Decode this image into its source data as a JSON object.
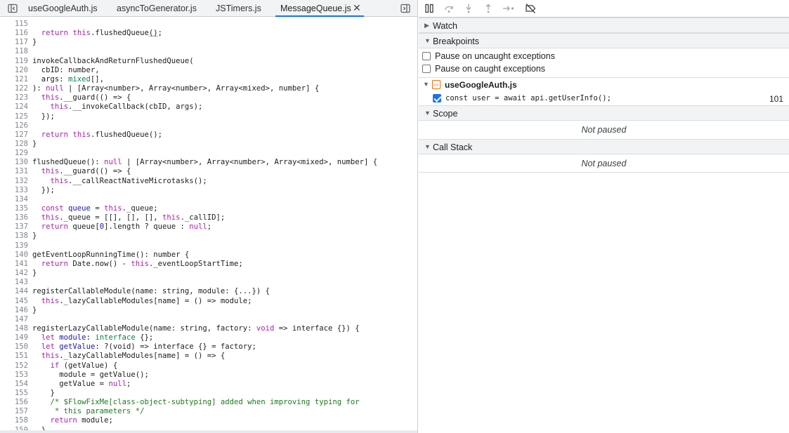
{
  "tabs": [
    {
      "label": "useGoogleAuth.js",
      "active": false
    },
    {
      "label": "asyncToGenerator.js",
      "active": false
    },
    {
      "label": "JSTimers.js",
      "active": false
    },
    {
      "label": "MessageQueue.js",
      "active": true
    }
  ],
  "tab_close_glyph": "✕",
  "code_lines": [
    {
      "n": "115",
      "html": ""
    },
    {
      "n": "116",
      "html": "  <span class=\"kw\">return</span> <span class=\"kw\">this</span>.flushedQueue<span class=\"hl\">()</span>;"
    },
    {
      "n": "117",
      "html": "}"
    },
    {
      "n": "118",
      "html": ""
    },
    {
      "n": "119",
      "html": "invokeCallbackAndReturnFlushedQueue("
    },
    {
      "n": "120",
      "html": "  cbID: number,"
    },
    {
      "n": "121",
      "html": "  args: <span class=\"ty\">mixed</span>[],"
    },
    {
      "n": "122",
      "html": "): <span class=\"kw\">null</span> | [Array&lt;number&gt;, Array&lt;number&gt;, Array&lt;mixed&gt;, number] {"
    },
    {
      "n": "123",
      "html": "  <span class=\"kw\">this</span>.__guard(() =&gt; {"
    },
    {
      "n": "124",
      "html": "    <span class=\"kw\">this</span>.__invokeCallback(cbID, args);"
    },
    {
      "n": "125",
      "html": "  });"
    },
    {
      "n": "126",
      "html": ""
    },
    {
      "n": "127",
      "html": "  <span class=\"kw\">return</span> <span class=\"kw\">this</span>.flushedQueue();"
    },
    {
      "n": "128",
      "html": "}"
    },
    {
      "n": "129",
      "html": ""
    },
    {
      "n": "130",
      "html": "flushedQueue(): <span class=\"kw\">null</span> | [Array&lt;number&gt;, Array&lt;number&gt;, Array&lt;mixed&gt;, number] {"
    },
    {
      "n": "131",
      "html": "  <span class=\"kw\">this</span>.__guard(() =&gt; {"
    },
    {
      "n": "132",
      "html": "    <span class=\"kw\">this</span>.__callReactNativeMicrotasks();"
    },
    {
      "n": "133",
      "html": "  });"
    },
    {
      "n": "134",
      "html": ""
    },
    {
      "n": "135",
      "html": "  <span class=\"kw\">const</span> <span class=\"vr\">queue</span> = <span class=\"kw\">this</span>._queue;"
    },
    {
      "n": "136",
      "html": "  <span class=\"kw\">this</span>._queue = [[], [], [], <span class=\"kw\">this</span>._callID];"
    },
    {
      "n": "137",
      "html": "  <span class=\"kw\">return</span> queue[<span class=\"nm\">0</span>].length ? queue : <span class=\"kw\">null</span>;"
    },
    {
      "n": "138",
      "html": "}"
    },
    {
      "n": "139",
      "html": ""
    },
    {
      "n": "140",
      "html": "getEventLoopRunningTime(): number {"
    },
    {
      "n": "141",
      "html": "  <span class=\"kw\">return</span> Date.now() - <span class=\"kw\">this</span>._eventLoopStartTime;"
    },
    {
      "n": "142",
      "html": "}"
    },
    {
      "n": "143",
      "html": ""
    },
    {
      "n": "144",
      "html": "registerCallableModule(name: string, module: {...}) {"
    },
    {
      "n": "145",
      "html": "  <span class=\"kw\">this</span>._lazyCallableModules[name] = () =&gt; module;"
    },
    {
      "n": "146",
      "html": "}"
    },
    {
      "n": "147",
      "html": ""
    },
    {
      "n": "148",
      "html": "registerLazyCallableModule(name: string, factory: <span class=\"kw\">void</span> =&gt; interface {}) {"
    },
    {
      "n": "149",
      "html": "  <span class=\"kw\">let</span> <span class=\"vr\">module</span>: <span class=\"ty\">interface</span> {};"
    },
    {
      "n": "150",
      "html": "  <span class=\"kw\">let</span> <span class=\"vr\">getValue</span>: ?(void) =&gt; interface {} = factory;"
    },
    {
      "n": "151",
      "html": "  <span class=\"kw\">this</span>._lazyCallableModules[name] = () =&gt; {"
    },
    {
      "n": "152",
      "html": "    <span class=\"kw\">if</span> (getValue) {"
    },
    {
      "n": "153",
      "html": "      module = getValue();"
    },
    {
      "n": "154",
      "html": "      getValue = <span class=\"kw\">null</span>;"
    },
    {
      "n": "155",
      "html": "    }"
    },
    {
      "n": "156",
      "html": "    <span class=\"cm\">/* $FlowFixMe[class-object-subtyping] added when improving typing for</span>"
    },
    {
      "n": "157",
      "html": "<span class=\"cm\">     * this parameters */</span>"
    },
    {
      "n": "158",
      "html": "    <span class=\"kw\">return</span> module;"
    },
    {
      "n": "159",
      "html": "  }"
    }
  ],
  "sidebar": {
    "watch": {
      "title": "Watch",
      "expanded": false
    },
    "breakpoints": {
      "title": "Breakpoints",
      "expanded": true,
      "options": [
        {
          "label": "Pause on uncaught exceptions",
          "checked": false
        },
        {
          "label": "Pause on caught exceptions",
          "checked": false
        }
      ],
      "file": "useGoogleAuth.js",
      "entry": {
        "code": "const user = await api.getUserInfo();",
        "line": "101",
        "checked": true
      }
    },
    "scope": {
      "title": "Scope",
      "status": "Not paused"
    },
    "call_stack": {
      "title": "Call Stack",
      "status": "Not paused"
    }
  },
  "colors": {
    "keyword": "#a626a4",
    "type": "#0b8043",
    "comment": "#1e7a1e",
    "number": "#1a1aa6",
    "accent": "#1a73e8"
  }
}
